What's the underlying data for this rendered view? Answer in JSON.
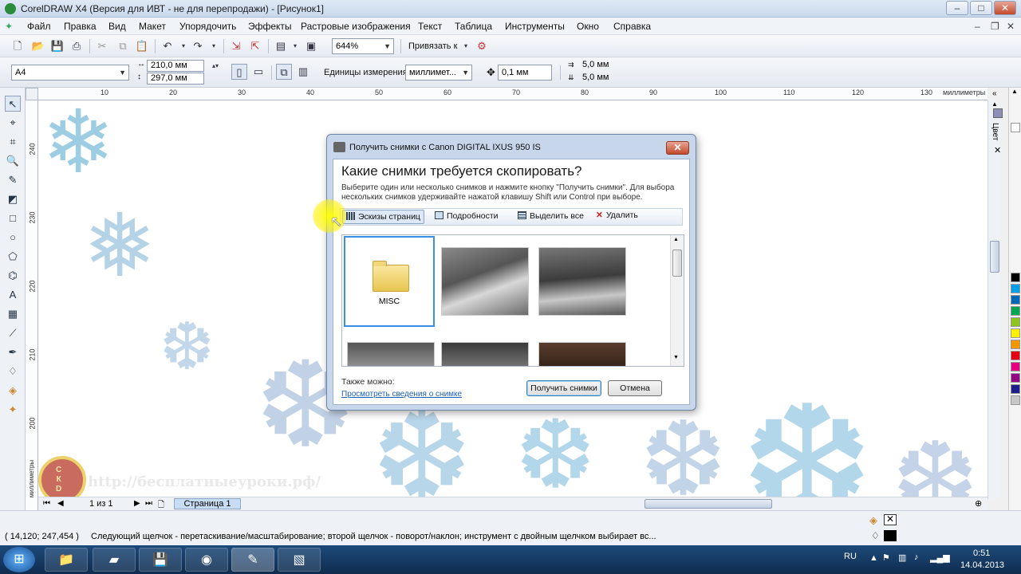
{
  "window": {
    "title": "CorelDRAW X4 (Версия для ИВТ - не для перепродажи) - [Рисунок1]",
    "controls": [
      "–",
      "□",
      "✕"
    ]
  },
  "menu": [
    "Файл",
    "Правка",
    "Вид",
    "Макет",
    "Упорядочить",
    "Эффекты",
    "Растровые изображения",
    "Текст",
    "Таблица",
    "Инструменты",
    "Окно",
    "Справка"
  ],
  "toolbar": {
    "zoom": "644%",
    "snap_label": "Привязать к"
  },
  "propbar": {
    "paper": "A4",
    "width": "210,0 мм",
    "height": "297,0 мм",
    "units_label": "Единицы измерения:",
    "units_value": "миллимет...",
    "nudge": "0,1 мм",
    "dup_x": "5,0 мм",
    "dup_y": "5,0 мм"
  },
  "ruler": {
    "h_ticks": [
      "10",
      "20",
      "30",
      "40",
      "50",
      "60",
      "70",
      "80",
      "90",
      "100",
      "110",
      "120",
      "130"
    ],
    "h_unit": "миллиметры",
    "v_ticks": [
      "240",
      "230",
      "220",
      "210",
      "200"
    ],
    "v_unit": "миллиметры"
  },
  "docker": {
    "label": "Цвет"
  },
  "palette": [
    "#ffffff",
    "#000000",
    "#00a0e9",
    "#0068b7",
    "#00a650",
    "#8fc31f",
    "#fff100",
    "#f39800",
    "#e60012",
    "#e4007f",
    "#920783",
    "#1d2088",
    "#c8c8c8"
  ],
  "pages": {
    "counter": "1 из 1",
    "tab": "Страница 1"
  },
  "status": {
    "coords": "( 14,120; 247,454 )",
    "hint": "Следующий щелчок - перетаскивание/масштабирование; второй щелчок - поворот/наклон; инструмент с двойным щелчком выбирает вс..."
  },
  "watermark": "http://бесплатныеуроки.рф/",
  "dialog": {
    "title": "Получить снимки с Canon DIGITAL IXUS 950 IS",
    "heading": "Какие снимки требуется скопировать?",
    "description": "Выберите один или несколько снимков и нажмите кнопку \"Получить снимки\". Для выбора нескольких снимков удерживайте нажатой клавишу Shift или Control при выборе.",
    "toolbar": [
      "Эскизы страниц",
      "Подробности",
      "Выделить все",
      "Удалить"
    ],
    "folder_name": "MISC",
    "also_label": "Также можно:",
    "info_link": "Просмотреть сведения о снимке",
    "ok_button": "Получить снимки",
    "cancel_button": "Отмена"
  },
  "taskbar": {
    "lang": "RU",
    "time": "0:51",
    "date": "14.04.2013"
  }
}
